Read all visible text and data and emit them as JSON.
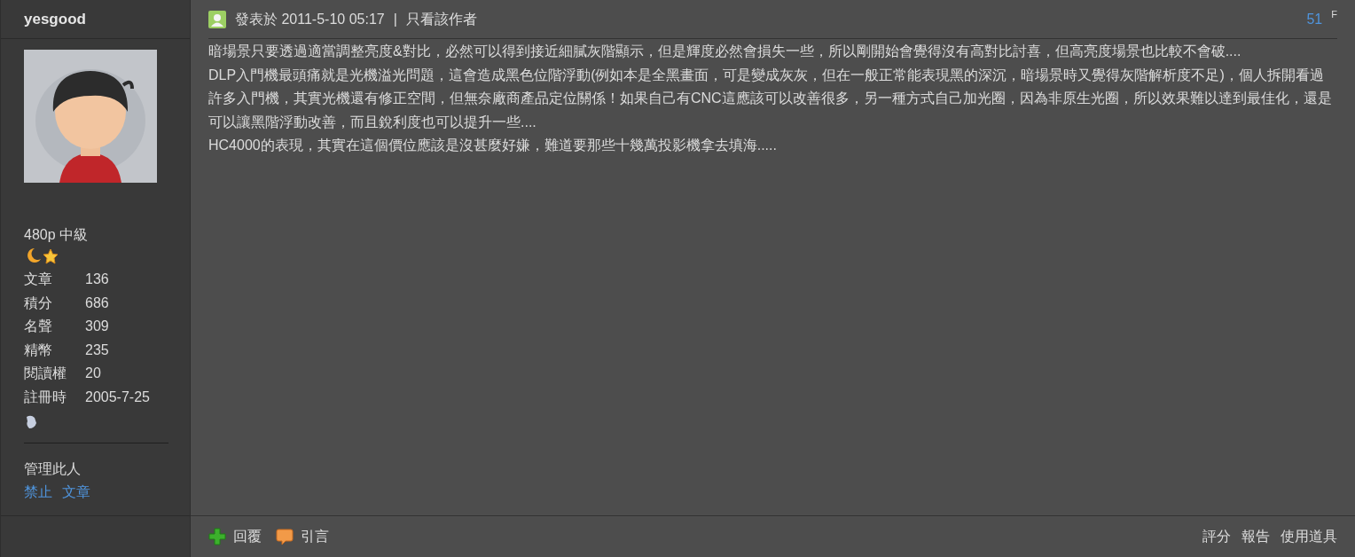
{
  "author": {
    "name": "yesgood",
    "rank": "480p 中級",
    "stats": [
      {
        "label": "文章",
        "value": "136"
      },
      {
        "label": "積分",
        "value": "686"
      },
      {
        "label": "名聲",
        "value": "309"
      },
      {
        "label": "精幣",
        "value": "235"
      },
      {
        "label": "閱讀權",
        "value": "20"
      },
      {
        "label": "註冊時",
        "value": "2005-7-25"
      }
    ],
    "manage": {
      "title": "管理此人",
      "links": [
        "禁止",
        "文章"
      ]
    }
  },
  "post": {
    "posted": "發表於 2011-5-10 05:17",
    "separator": "|",
    "author_only": "只看該作者",
    "floor": "51",
    "floor_suffix": "F",
    "paragraphs": [
      "暗場景只要透過適當調整亮度&對比，必然可以得到接近細膩灰階顯示，但是輝度必然會損失一些，所以剛開始會覺得沒有高對比討喜，但高亮度場景也比較不會破....",
      "DLP入門機最頭痛就是光機溢光問題，這會造成黑色位階浮動(例如本是全黑畫面，可是變成灰灰，但在一般正常能表現黑的深沉，暗場景時又覺得灰階解析度不足)，個人拆開看過許多入門機，其實光機還有修正空間，但無奈廠商產品定位關係！如果自己有CNC這應該可以改善很多，另一種方式自己加光圈，因為非原生光圈，所以效果難以達到最佳化，還是可以讓黑階浮動改善，而且銳利度也可以提升一些....",
      "HC4000的表現，其實在這個價位應該是沒甚麼好嫌，難道要那些十幾萬投影機拿去填海....."
    ]
  },
  "actions_left": [
    {
      "kind": "reply",
      "label": "回覆"
    },
    {
      "kind": "quote",
      "label": "引言"
    }
  ],
  "actions_right": [
    "評分",
    "報告",
    "使用道具"
  ]
}
